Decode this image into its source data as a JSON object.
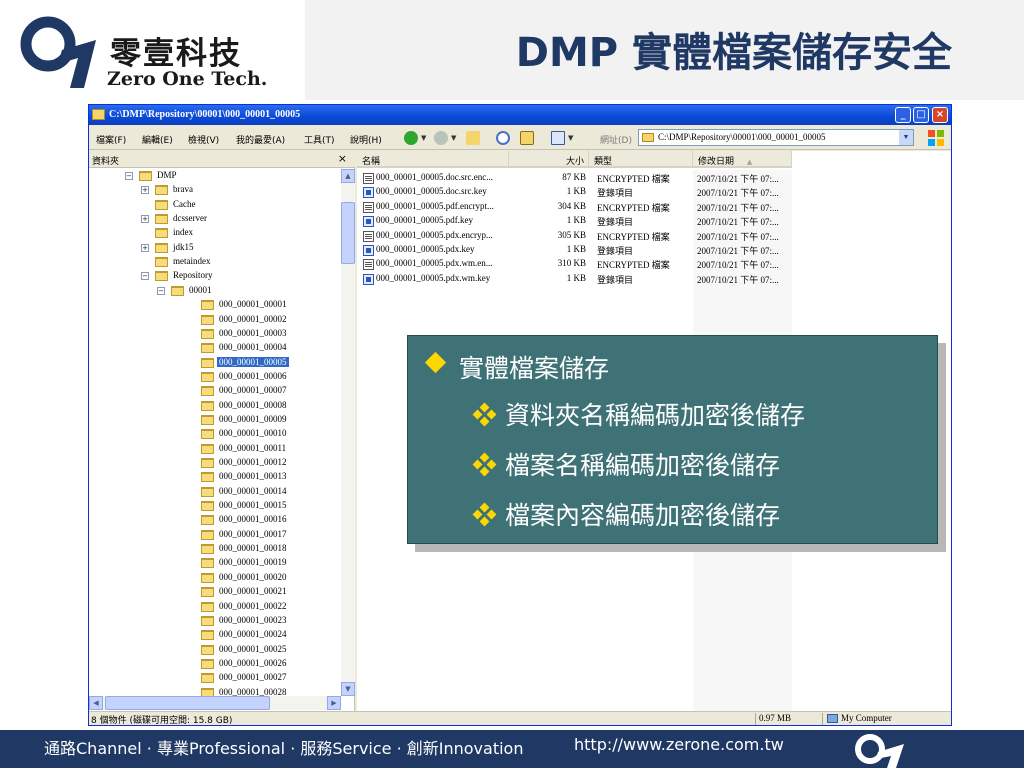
{
  "slide": {
    "logo_cn": "零壹科技",
    "logo_en": "Zero One Tech.",
    "title": "DMP 實體檔案儲存安全"
  },
  "window": {
    "title": "C:\\DMP\\Repository\\00001\\000_00001_00005",
    "buttons": {
      "minimize": "_",
      "maximize": "□",
      "close": "×"
    }
  },
  "menu": {
    "items": [
      "檔案(F)",
      "編輯(E)",
      "檢視(V)",
      "我的最愛(A)",
      "工具(T)",
      "說明(H)"
    ],
    "address_label": "網址(D)",
    "address_value": "C:\\DMP\\Repository\\00001\\000_00001_00005"
  },
  "folder_pane": {
    "header": "資料夾",
    "close": "×",
    "tree": [
      {
        "label": "DMP",
        "expander": "−"
      },
      {
        "label": "brava",
        "expander": "+"
      },
      {
        "label": "Cache",
        "expander": ""
      },
      {
        "label": "dcsserver",
        "expander": "+"
      },
      {
        "label": "index",
        "expander": ""
      },
      {
        "label": "jdk15",
        "expander": "+"
      },
      {
        "label": "metaindex",
        "expander": ""
      },
      {
        "label": "Repository",
        "expander": "−"
      },
      {
        "label": "00001",
        "expander": "−"
      },
      {
        "label": "000_00001_00001",
        "expander": ""
      },
      {
        "label": "000_00001_00002",
        "expander": ""
      },
      {
        "label": "000_00001_00003",
        "expander": ""
      },
      {
        "label": "000_00001_00004",
        "expander": ""
      },
      {
        "label": "000_00001_00005",
        "expander": "",
        "selected": true
      },
      {
        "label": "000_00001_00006",
        "expander": ""
      },
      {
        "label": "000_00001_00007",
        "expander": ""
      },
      {
        "label": "000_00001_00008",
        "expander": ""
      },
      {
        "label": "000_00001_00009",
        "expander": ""
      },
      {
        "label": "000_00001_00010",
        "expander": ""
      },
      {
        "label": "000_00001_00011",
        "expander": ""
      },
      {
        "label": "000_00001_00012",
        "expander": ""
      },
      {
        "label": "000_00001_00013",
        "expander": ""
      },
      {
        "label": "000_00001_00014",
        "expander": ""
      },
      {
        "label": "000_00001_00015",
        "expander": ""
      },
      {
        "label": "000_00001_00016",
        "expander": ""
      },
      {
        "label": "000_00001_00017",
        "expander": ""
      },
      {
        "label": "000_00001_00018",
        "expander": ""
      },
      {
        "label": "000_00001_00019",
        "expander": ""
      },
      {
        "label": "000_00001_00020",
        "expander": ""
      },
      {
        "label": "000_00001_00021",
        "expander": ""
      },
      {
        "label": "000_00001_00022",
        "expander": ""
      },
      {
        "label": "000_00001_00023",
        "expander": ""
      },
      {
        "label": "000_00001_00024",
        "expander": ""
      },
      {
        "label": "000_00001_00025",
        "expander": ""
      },
      {
        "label": "000_00001_00026",
        "expander": ""
      },
      {
        "label": "000_00001_00027",
        "expander": ""
      },
      {
        "label": "000_00001_00028",
        "expander": ""
      }
    ]
  },
  "file_list": {
    "columns": [
      "名稱",
      "大小",
      "類型",
      "修改日期"
    ],
    "sort_indicator": "▲",
    "rows": [
      {
        "name": "000_00001_00005.doc.src.enc...",
        "size": "87 KB",
        "type": "ENCRYPTED 檔案",
        "date": "2007/10/21 下午 07:...",
        "icon": "enc"
      },
      {
        "name": "000_00001_00005.doc.src.key",
        "size": "1 KB",
        "type": "登錄項目",
        "date": "2007/10/21 下午 07:...",
        "icon": "reg"
      },
      {
        "name": "000_00001_00005.pdf.encrypt...",
        "size": "304 KB",
        "type": "ENCRYPTED 檔案",
        "date": "2007/10/21 下午 07:...",
        "icon": "enc"
      },
      {
        "name": "000_00001_00005.pdf.key",
        "size": "1 KB",
        "type": "登錄項目",
        "date": "2007/10/21 下午 07:...",
        "icon": "reg"
      },
      {
        "name": "000_00001_00005.pdx.encryp...",
        "size": "305 KB",
        "type": "ENCRYPTED 檔案",
        "date": "2007/10/21 下午 07:...",
        "icon": "enc"
      },
      {
        "name": "000_00001_00005.pdx.key",
        "size": "1 KB",
        "type": "登錄項目",
        "date": "2007/10/21 下午 07:...",
        "icon": "reg"
      },
      {
        "name": "000_00001_00005.pdx.wm.en...",
        "size": "310 KB",
        "type": "ENCRYPTED 檔案",
        "date": "2007/10/21 下午 07:...",
        "icon": "enc"
      },
      {
        "name": "000_00001_00005.pdx.wm.key",
        "size": "1 KB",
        "type": "登錄項目",
        "date": "2007/10/21 下午 07:...",
        "icon": "reg"
      }
    ]
  },
  "status": {
    "left": "8 個物件 (磁碟可用空間: 15.8 GB)",
    "size": "0.97 MB",
    "location": "My Computer"
  },
  "callout": {
    "main": "實體檔案儲存",
    "subs": [
      "資料夾名稱編碼加密後儲存",
      "檔案名稱編碼加密後儲存",
      "檔案內容編碼加密後儲存"
    ]
  },
  "footer": {
    "tagline": "通路Channel · 專業Professional · 服務Service · 創新Innovation",
    "url": "http://www.zerone.com.tw"
  },
  "colors": {
    "title": "#1f3864",
    "footer": "#1f3864",
    "callout": "#3e7277",
    "bullet": "#ffd700",
    "selection": "#316ac5"
  }
}
